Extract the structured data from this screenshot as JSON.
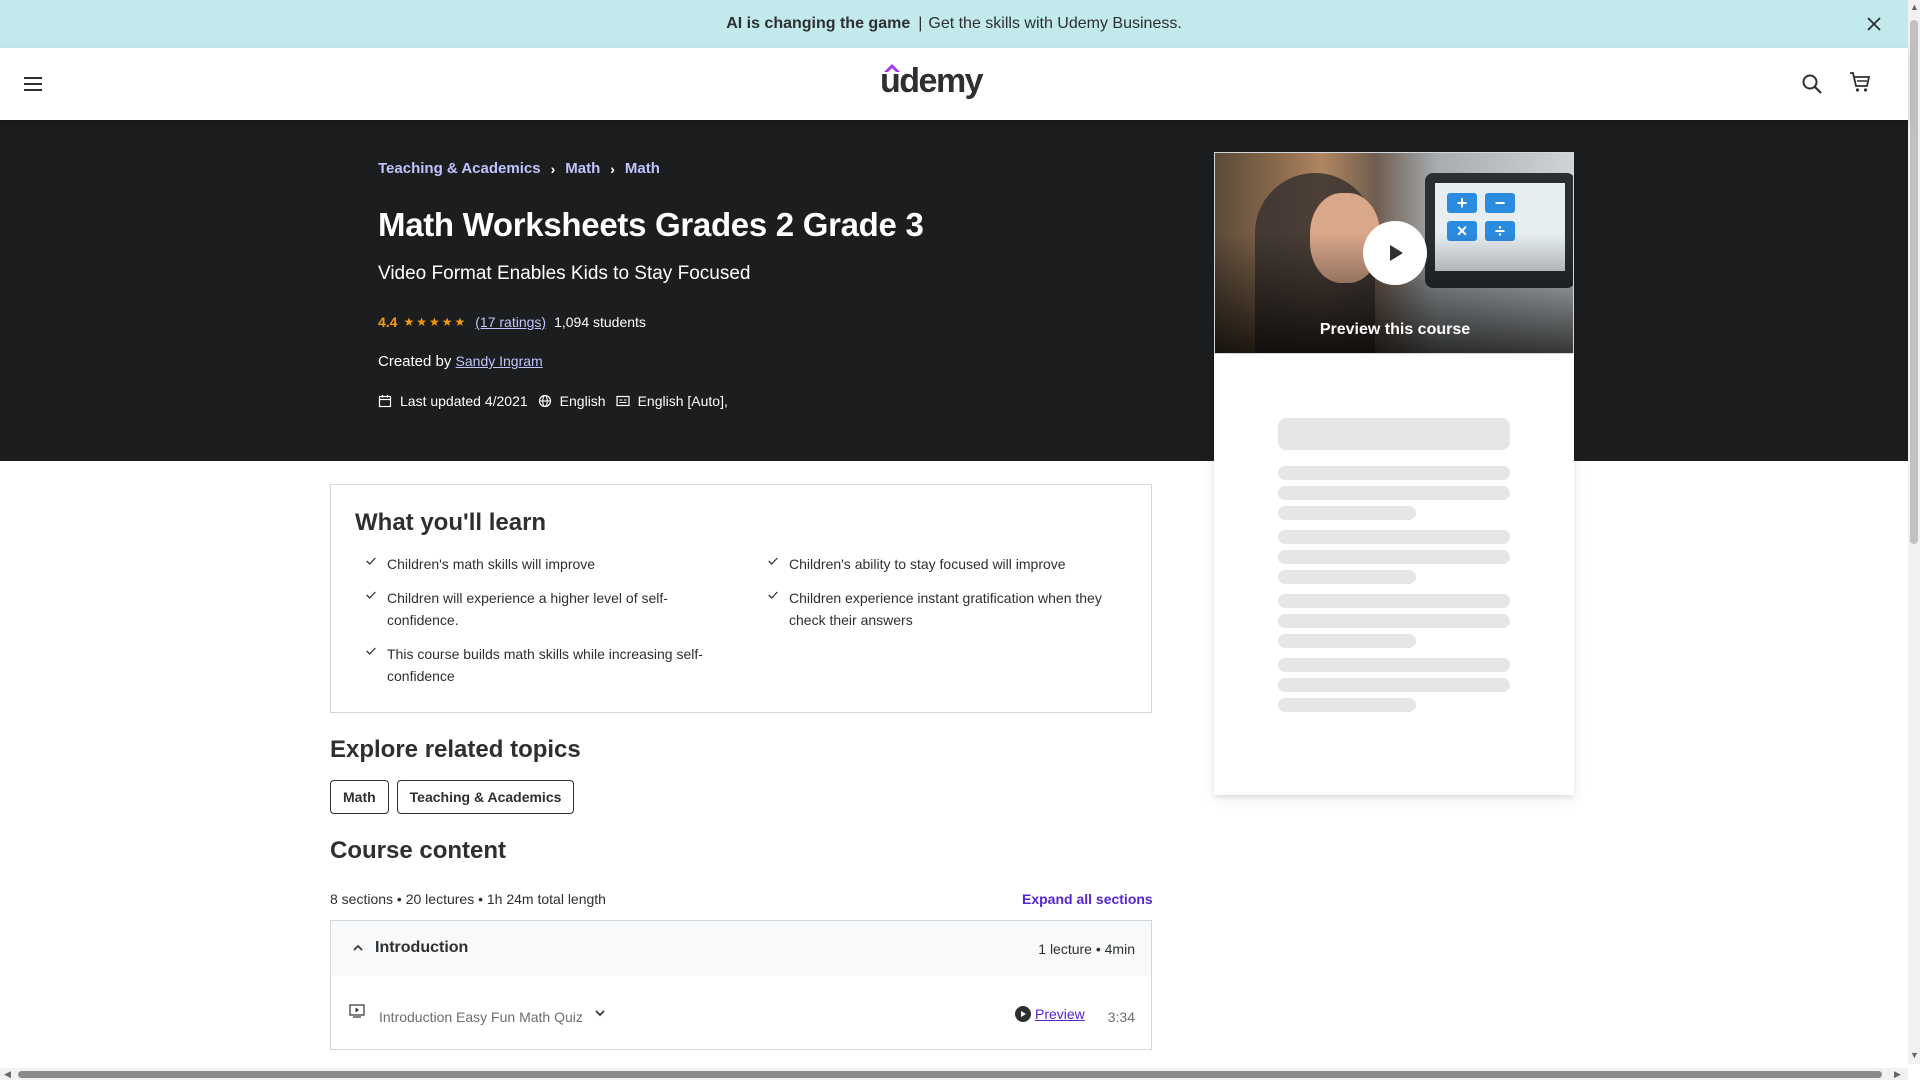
{
  "banner": {
    "bold": "AI is changing the game",
    "separator": "|",
    "text": "Get the skills with Udemy Business."
  },
  "header": {
    "logo": "udemy"
  },
  "breadcrumb": [
    "Teaching & Academics",
    "Math",
    "Math"
  ],
  "course": {
    "title": "Math Worksheets Grades 2 Grade 3",
    "subtitle": "Video Format Enables Kids to Stay Focused",
    "rating": "4.4",
    "stars": "★★★★★",
    "rating_count": "(17 ratings)",
    "students": "1,094 students",
    "created_by_label": "Created by",
    "instructor": "Sandy Ingram",
    "last_updated": "Last updated 4/2021",
    "language": "English",
    "captions": "English [Auto],"
  },
  "preview": {
    "label": "Preview this course"
  },
  "learn": {
    "title": "What you'll learn",
    "items": [
      "Children's math skills will improve",
      "Children's ability to stay focused will improve",
      "Children will experience a higher level of self-confidence.",
      "Children experience instant gratification when they check their answers",
      "This course builds math skills while increasing self-confidence"
    ]
  },
  "topics": {
    "title": "Explore related topics",
    "items": [
      "Math",
      "Teaching & Academics"
    ]
  },
  "content": {
    "title": "Course content",
    "summary": "8 sections • 20 lectures • 1h 24m total length",
    "expand_all": "Expand all sections",
    "section": {
      "name": "Introduction",
      "meta": "1 lecture • 4min"
    },
    "lecture": {
      "name": "Introduction Easy Fun Math Quiz",
      "preview": "Preview",
      "duration": "3:34"
    }
  },
  "colors": {
    "banner_bg": "#c2e9eb",
    "hero_bg": "#1c1d1f",
    "accent_link": "#c0c4fc",
    "brand_purple": "#5624d0",
    "star": "#f69c08"
  }
}
